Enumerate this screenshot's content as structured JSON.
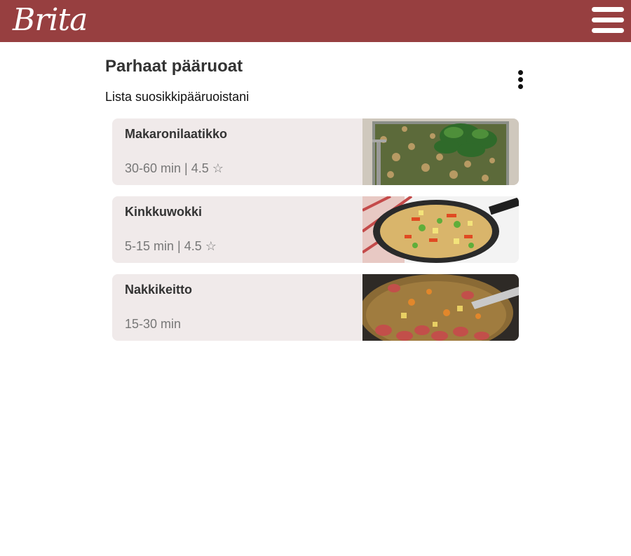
{
  "header": {
    "logo_text": "Brita",
    "menu_icon": "hamburger-menu-icon",
    "background_color": "#973f40"
  },
  "main": {
    "title": "Parhaat pääruoat",
    "subtitle": "Lista suosikkipääruoistani",
    "more_icon": "kebab-menu-icon"
  },
  "recipes": [
    {
      "title": "Makaronilaatikko",
      "meta": "30-60 min | 4.5 ☆",
      "image": "macaroni-casserole-photo"
    },
    {
      "title": "Kinkkuwokki",
      "meta": "5-15 min | 4.5 ☆",
      "image": "ham-wok-pan-photo"
    },
    {
      "title": "Nakkikeitto",
      "meta": "15-30 min",
      "image": "sausage-soup-pot-photo"
    }
  ]
}
